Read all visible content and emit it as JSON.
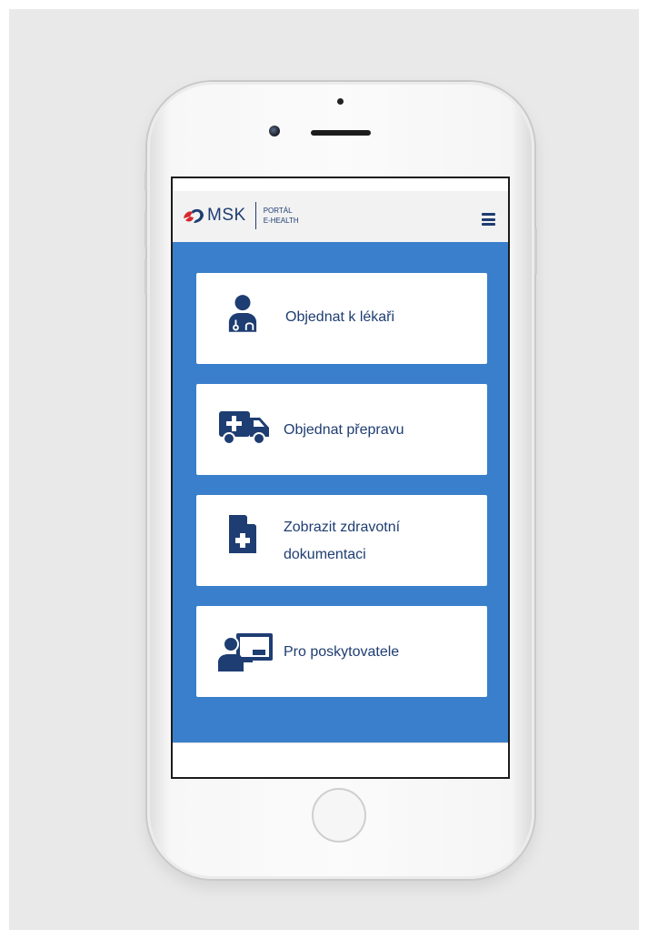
{
  "header": {
    "logo_text": "MSK",
    "portal_line1": "PORTÁL",
    "portal_line2": "E-HEALTH",
    "menu_icon": "hamburger-menu-icon"
  },
  "cards": [
    {
      "label": "Objednat k lékaři",
      "icon": "doctor-icon"
    },
    {
      "label": "Objednat přepravu",
      "icon": "ambulance-icon"
    },
    {
      "label_line1": "Zobrazit zdravotní",
      "label_line2": "dokumentaci",
      "icon": "medical-document-icon"
    },
    {
      "label": "Pro poskytovatele",
      "icon": "presenter-icon"
    }
  ],
  "colors": {
    "primary": "#3a7fcb",
    "text": "#1e3d72",
    "logo_red": "#d7262e",
    "header_bg": "#f2f2f2"
  }
}
